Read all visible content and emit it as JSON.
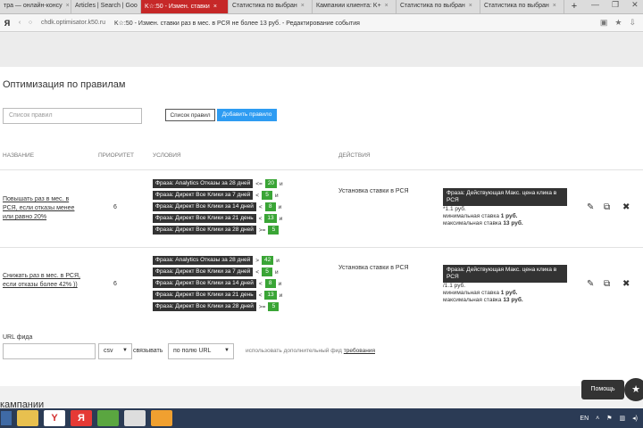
{
  "browser": {
    "tabs": [
      {
        "label": "тра — онлайн-консу",
        "active": false
      },
      {
        "label": "Articles | Search | Goo",
        "active": false
      },
      {
        "label": "K☆:50 - Измен. ставки",
        "active": true
      },
      {
        "label": "Статистика по выбран",
        "active": false
      },
      {
        "label": "Кампании клиента: K+",
        "active": false
      },
      {
        "label": "Статистика по выбран",
        "active": false
      },
      {
        "label": "Статистика по выбран",
        "active": false
      }
    ],
    "new_tab": "+",
    "yandex_glyph": "Я",
    "host": "chdk.optimisator.k50.ru",
    "page_title": "K☆:50 - Измен. ставки раз в мес. в РСЯ не более 13 руб. - Редактирование события"
  },
  "page": {
    "heading": "Оптимизация по правилам",
    "search_placeholder": "Список правил",
    "rules_list_button": "Список правил",
    "add_rule_button": "Добавить правило",
    "columns": {
      "name": "НАЗВАНИЕ",
      "priority": "ПРИОРИТЕТ",
      "conditions": "УСЛОВИЯ",
      "actions": "ДЕЙСТВИЯ"
    },
    "rules": [
      {
        "name": "Повышать раз в мес. в РСЯ, если отказы менее или равно 20%",
        "priority": "6",
        "conditions": [
          {
            "label": "Фраза: Analytics Отказы за 28 дней",
            "op": "<=",
            "value": "20",
            "join": "и"
          },
          {
            "label": "Фраза: Директ Все Клики за 7 дней",
            "op": "<",
            "value": "5",
            "join": "и"
          },
          {
            "label": "Фраза: Директ Все Клики за 14 дней",
            "op": "<",
            "value": "8",
            "join": "и"
          },
          {
            "label": "Фраза: Директ Все Клики за 21 день",
            "op": "<",
            "value": "13",
            "join": "и"
          },
          {
            "label": "Фраза: Директ Все Клики за 28 дней",
            "op": ">=",
            "value": "5",
            "join": ""
          }
        ],
        "action": "Установка ставки в РСЯ",
        "param_badge": "Фраза: Действующая Макс. цена клика в РСЯ",
        "param_mult": "*1.1 руб.",
        "min_bid_label": "минимальная ставка",
        "min_bid_value": "1 руб.",
        "max_bid_label": "максимальная ставка",
        "max_bid_value": "13 руб."
      },
      {
        "name": "Снижать раз в мес. в РСЯ, если отказы более 42% ))",
        "priority": "6",
        "conditions": [
          {
            "label": "Фраза: Analytics Отказы за 28 дней",
            "op": ">",
            "value": "42",
            "join": "и"
          },
          {
            "label": "Фраза: Директ Все Клики за 7 дней",
            "op": "<",
            "value": "5",
            "join": "и"
          },
          {
            "label": "Фраза: Директ Все Клики за 14 дней",
            "op": "<",
            "value": "8",
            "join": "и"
          },
          {
            "label": "Фраза: Директ Все Клики за 21 день",
            "op": "<",
            "value": "13",
            "join": "и"
          },
          {
            "label": "Фраза: Директ Все Клики за 28 дней",
            "op": ">=",
            "value": "5",
            "join": ""
          }
        ],
        "action": "Установка ставки в РСЯ",
        "param_badge": "Фраза: Действующая Макс. цена клика в РСЯ",
        "param_mult": "/1.1 руб.",
        "min_bid_label": "минимальная ставка",
        "min_bid_value": "1 руб.",
        "max_bid_label": "максимальная ставка",
        "max_bid_value": "13 руб."
      }
    ],
    "feed_url_label": "URL фида",
    "format_value": "csv",
    "bind_label": "связывать",
    "bind_field_value": "по полю URL",
    "extra_text": "использовать дополнительный фид",
    "extra_link": "требования",
    "campaigns_heading": "кампании",
    "help_label": "Помощь"
  },
  "taskbar": {
    "lang": "EN"
  },
  "colors": {
    "accent": "#2e9cf2",
    "value_green": "#3aa536",
    "label_dark": "#333333",
    "active_tab": "#c62828"
  }
}
